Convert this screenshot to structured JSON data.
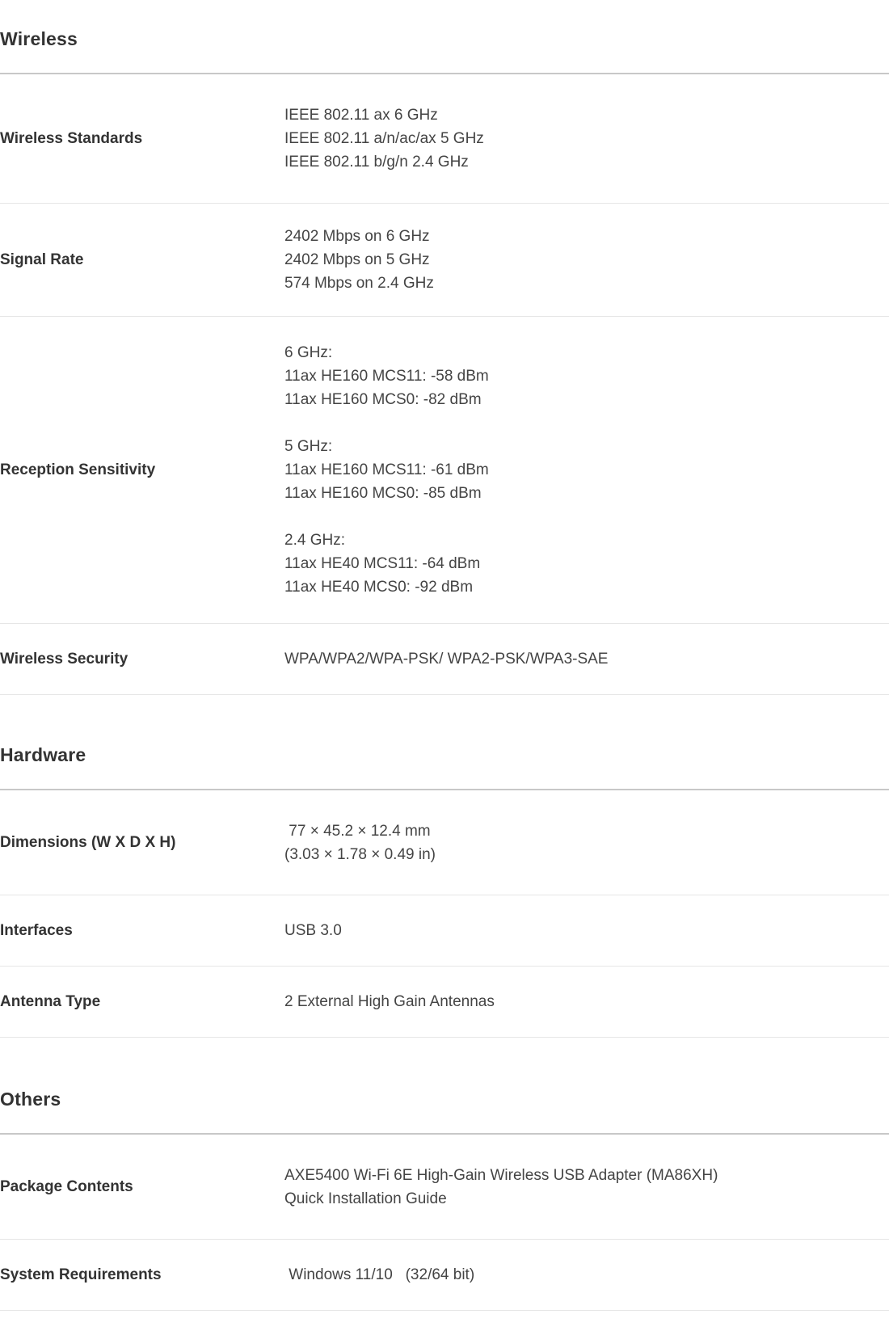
{
  "sections": [
    {
      "title": "Wireless",
      "rows": [
        {
          "label": "Wireless Standards",
          "values": [
            "IEEE 802.11 ax 6 GHz",
            "IEEE 802.11 a/n/ac/ax 5 GHz",
            "IEEE 802.11 b/g/n 2.4 GHz"
          ]
        },
        {
          "label": "Signal Rate",
          "values": [
            "2402 Mbps on 6 GHz",
            "2402 Mbps on 5 GHz",
            "574 Mbps on 2.4 GHz"
          ]
        },
        {
          "label": "Reception Sensitivity",
          "values": [
            "6 GHz:",
            "11ax HE160 MCS11: -58 dBm",
            "11ax HE160 MCS0: -82 dBm",
            "",
            "5 GHz:",
            "11ax HE160 MCS11: -61 dBm",
            "11ax HE160 MCS0: -85 dBm",
            "",
            "2.4 GHz:",
            "11ax HE40 MCS11: -64 dBm",
            "11ax HE40 MCS0: -92 dBm"
          ]
        },
        {
          "label": "Wireless Security",
          "values": [
            "WPA/WPA2/WPA-PSK/ WPA2-PSK/WPA3-SAE"
          ]
        }
      ]
    },
    {
      "title": "Hardware",
      "rows": [
        {
          "label": "Dimensions (W X D X H)",
          "values": [
            " 77 × 45.2 × 12.4 mm",
            "(3.03 × 1.78 × 0.49 in)"
          ]
        },
        {
          "label": "Interfaces",
          "values": [
            "USB 3.0"
          ]
        },
        {
          "label": "Antenna Type",
          "values": [
            "2 External High Gain Antennas"
          ]
        }
      ]
    },
    {
      "title": "Others",
      "rows": [
        {
          "label": "Package Contents",
          "values": [
            "AXE5400 Wi-Fi 6E High-Gain Wireless USB Adapter (MA86XH)",
            "Quick Installation Guide"
          ]
        },
        {
          "label": "System Requirements",
          "values": [
            " Windows 11/10   (32/64 bit)"
          ]
        }
      ]
    }
  ]
}
